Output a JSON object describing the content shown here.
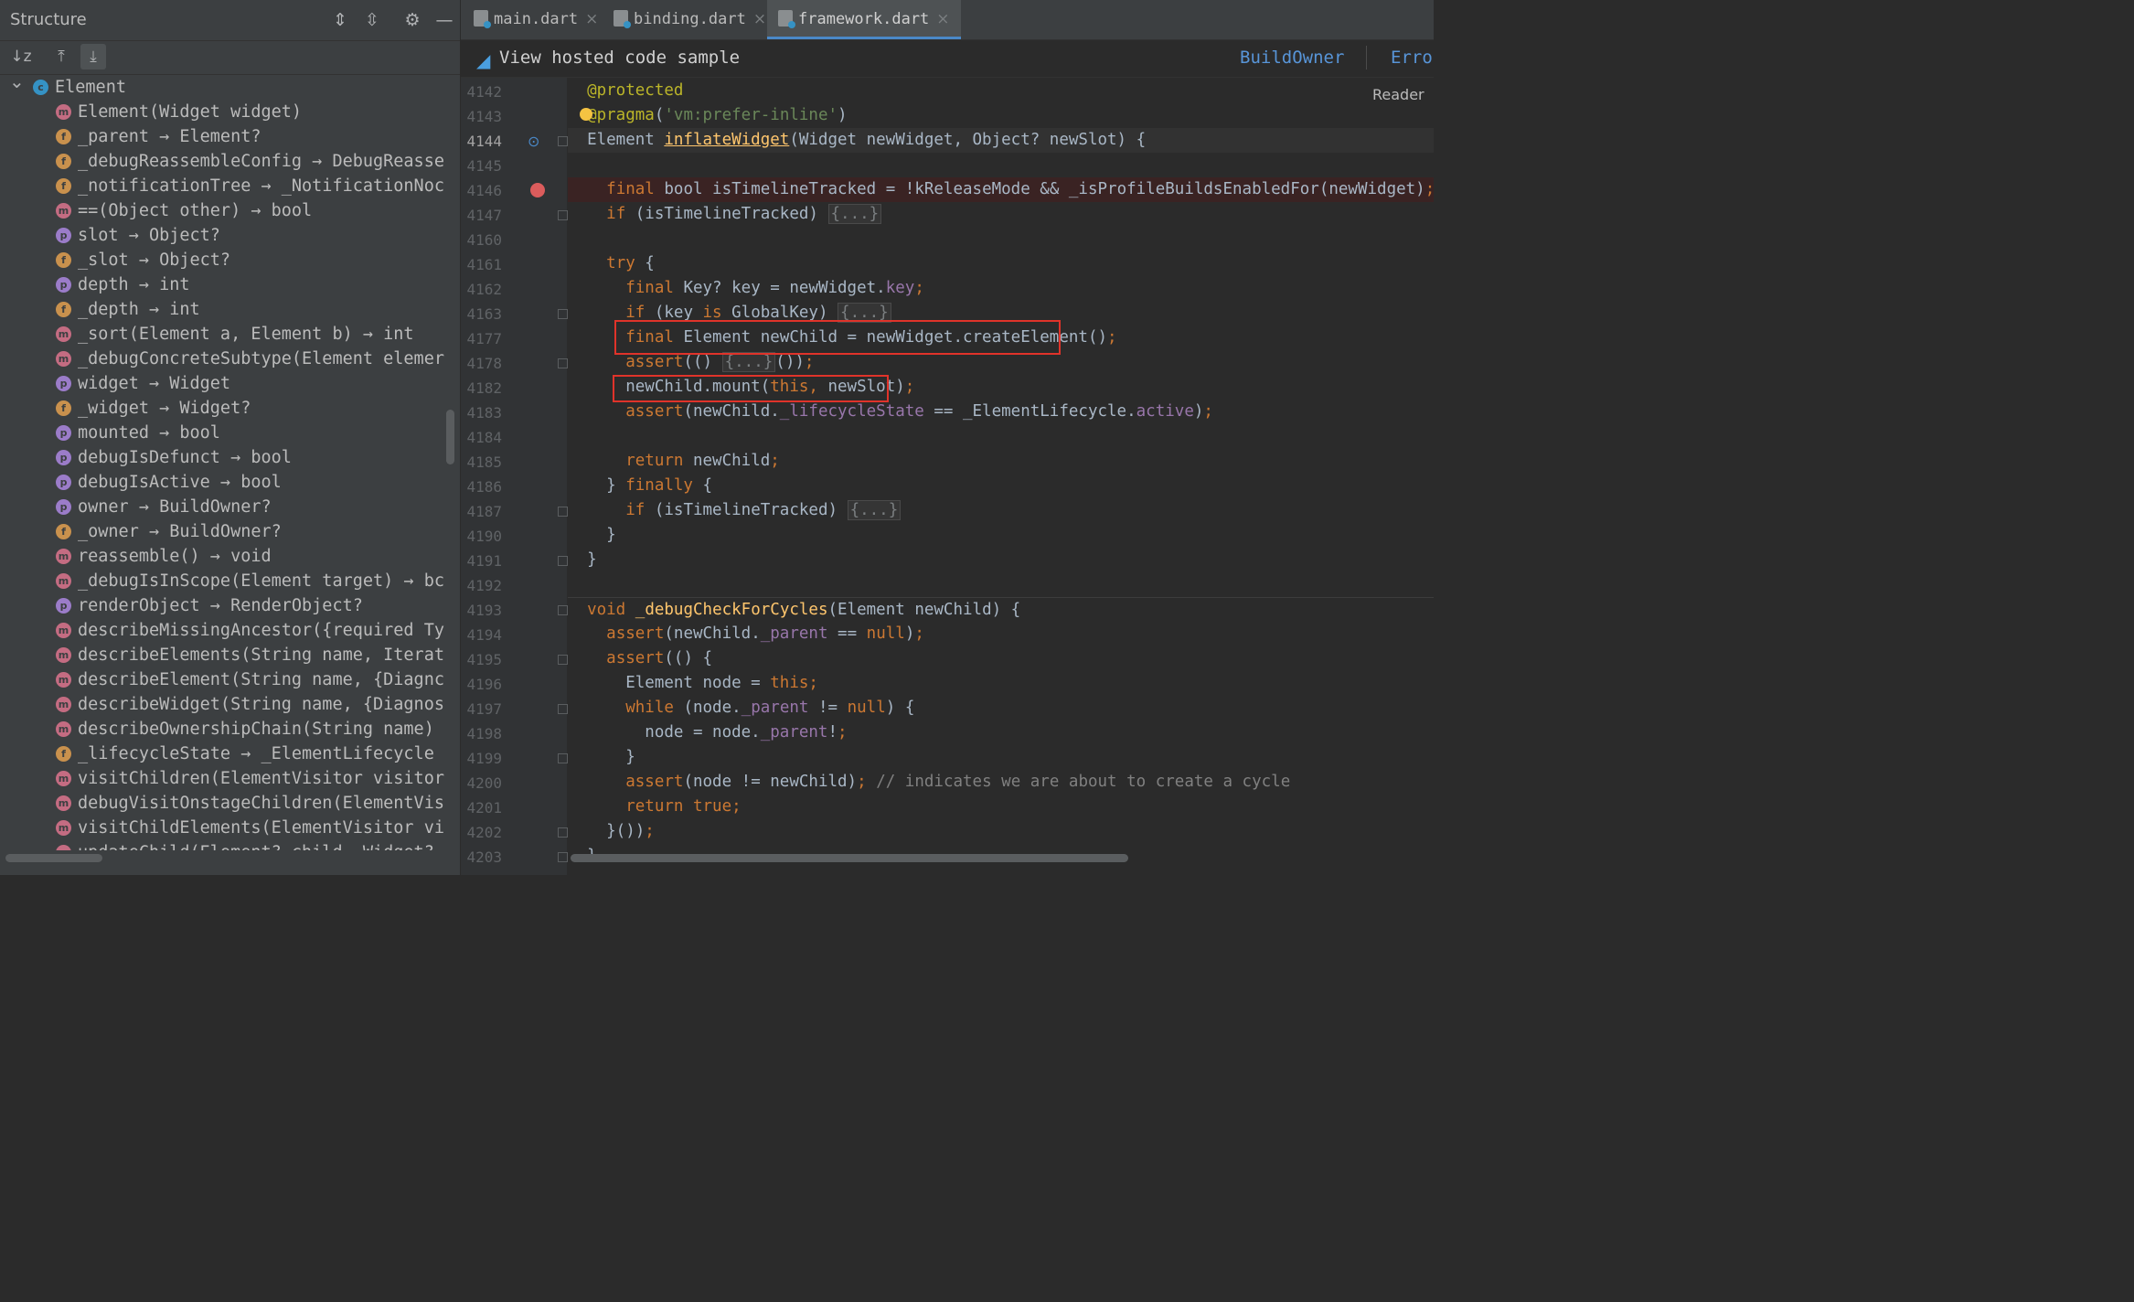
{
  "structure": {
    "title": "Structure",
    "tree": [
      {
        "icon": "c",
        "text": "Element",
        "root": true
      },
      {
        "icon": "m",
        "text": "Element(Widget widget)"
      },
      {
        "icon": "f",
        "text": "_parent → Element?"
      },
      {
        "icon": "f",
        "text": "_debugReassembleConfig → DebugReasse"
      },
      {
        "icon": "f",
        "text": "_notificationTree → _NotificationNoc"
      },
      {
        "icon": "m",
        "text": "==(Object other) → bool"
      },
      {
        "icon": "p",
        "text": "slot → Object?"
      },
      {
        "icon": "f",
        "text": "_slot → Object?"
      },
      {
        "icon": "p",
        "text": "depth → int"
      },
      {
        "icon": "f",
        "text": "_depth → int"
      },
      {
        "icon": "m",
        "text": "_sort(Element a, Element b) → int"
      },
      {
        "icon": "m",
        "text": "_debugConcreteSubtype(Element elemer"
      },
      {
        "icon": "p",
        "text": "widget → Widget"
      },
      {
        "icon": "f",
        "text": "_widget → Widget?"
      },
      {
        "icon": "p",
        "text": "mounted → bool"
      },
      {
        "icon": "p",
        "text": "debugIsDefunct → bool"
      },
      {
        "icon": "p",
        "text": "debugIsActive → bool"
      },
      {
        "icon": "p",
        "text": "owner → BuildOwner?"
      },
      {
        "icon": "f",
        "text": "_owner → BuildOwner?"
      },
      {
        "icon": "m",
        "text": "reassemble() → void"
      },
      {
        "icon": "m",
        "text": "_debugIsInScope(Element target) → bc"
      },
      {
        "icon": "p",
        "text": "renderObject → RenderObject?"
      },
      {
        "icon": "m",
        "text": "describeMissingAncestor({required Ty"
      },
      {
        "icon": "m",
        "text": "describeElements(String name, Iterat"
      },
      {
        "icon": "m",
        "text": "describeElement(String name, {Diagnc"
      },
      {
        "icon": "m",
        "text": "describeWidget(String name, {Diagnos"
      },
      {
        "icon": "m",
        "text": "describeOwnershipChain(String name)"
      },
      {
        "icon": "f",
        "text": "_lifecycleState → _ElementLifecycle"
      },
      {
        "icon": "m",
        "text": "visitChildren(ElementVisitor visitor"
      },
      {
        "icon": "m",
        "text": "debugVisitOnstageChildren(ElementVis"
      },
      {
        "icon": "m",
        "text": "visitChildElements(ElementVisitor vi"
      },
      {
        "icon": "m",
        "text": "updateChild(Element? child, Widget?"
      }
    ]
  },
  "tabs": [
    {
      "label": "main.dart",
      "close": "×"
    },
    {
      "label": "binding.dart",
      "close": "×"
    },
    {
      "label": "framework.dart",
      "close": "×",
      "active": true
    }
  ],
  "infobar": {
    "text": "View hosted code sample",
    "crumb1": "BuildOwner",
    "crumb2": "Erro",
    "reader": "Reader"
  },
  "line_numbers": [
    "4142",
    "4143",
    "4144",
    "4145",
    "4146",
    "4147",
    "4160",
    "4161",
    "4162",
    "4163",
    "4177",
    "4178",
    "4182",
    "4183",
    "4184",
    "4185",
    "4186",
    "4187",
    "4190",
    "4191",
    "4192",
    "4193",
    "4194",
    "4195",
    "4196",
    "4197",
    "4198",
    "4199",
    "4200",
    "4201",
    "4202",
    "4203"
  ],
  "colors": {
    "breakpoint": "#db5c5c",
    "highlight_box": "#e0332a",
    "keyword": "#cc7832",
    "function": "#ffc66d",
    "property": "#9876aa",
    "string": "#6a8759"
  }
}
